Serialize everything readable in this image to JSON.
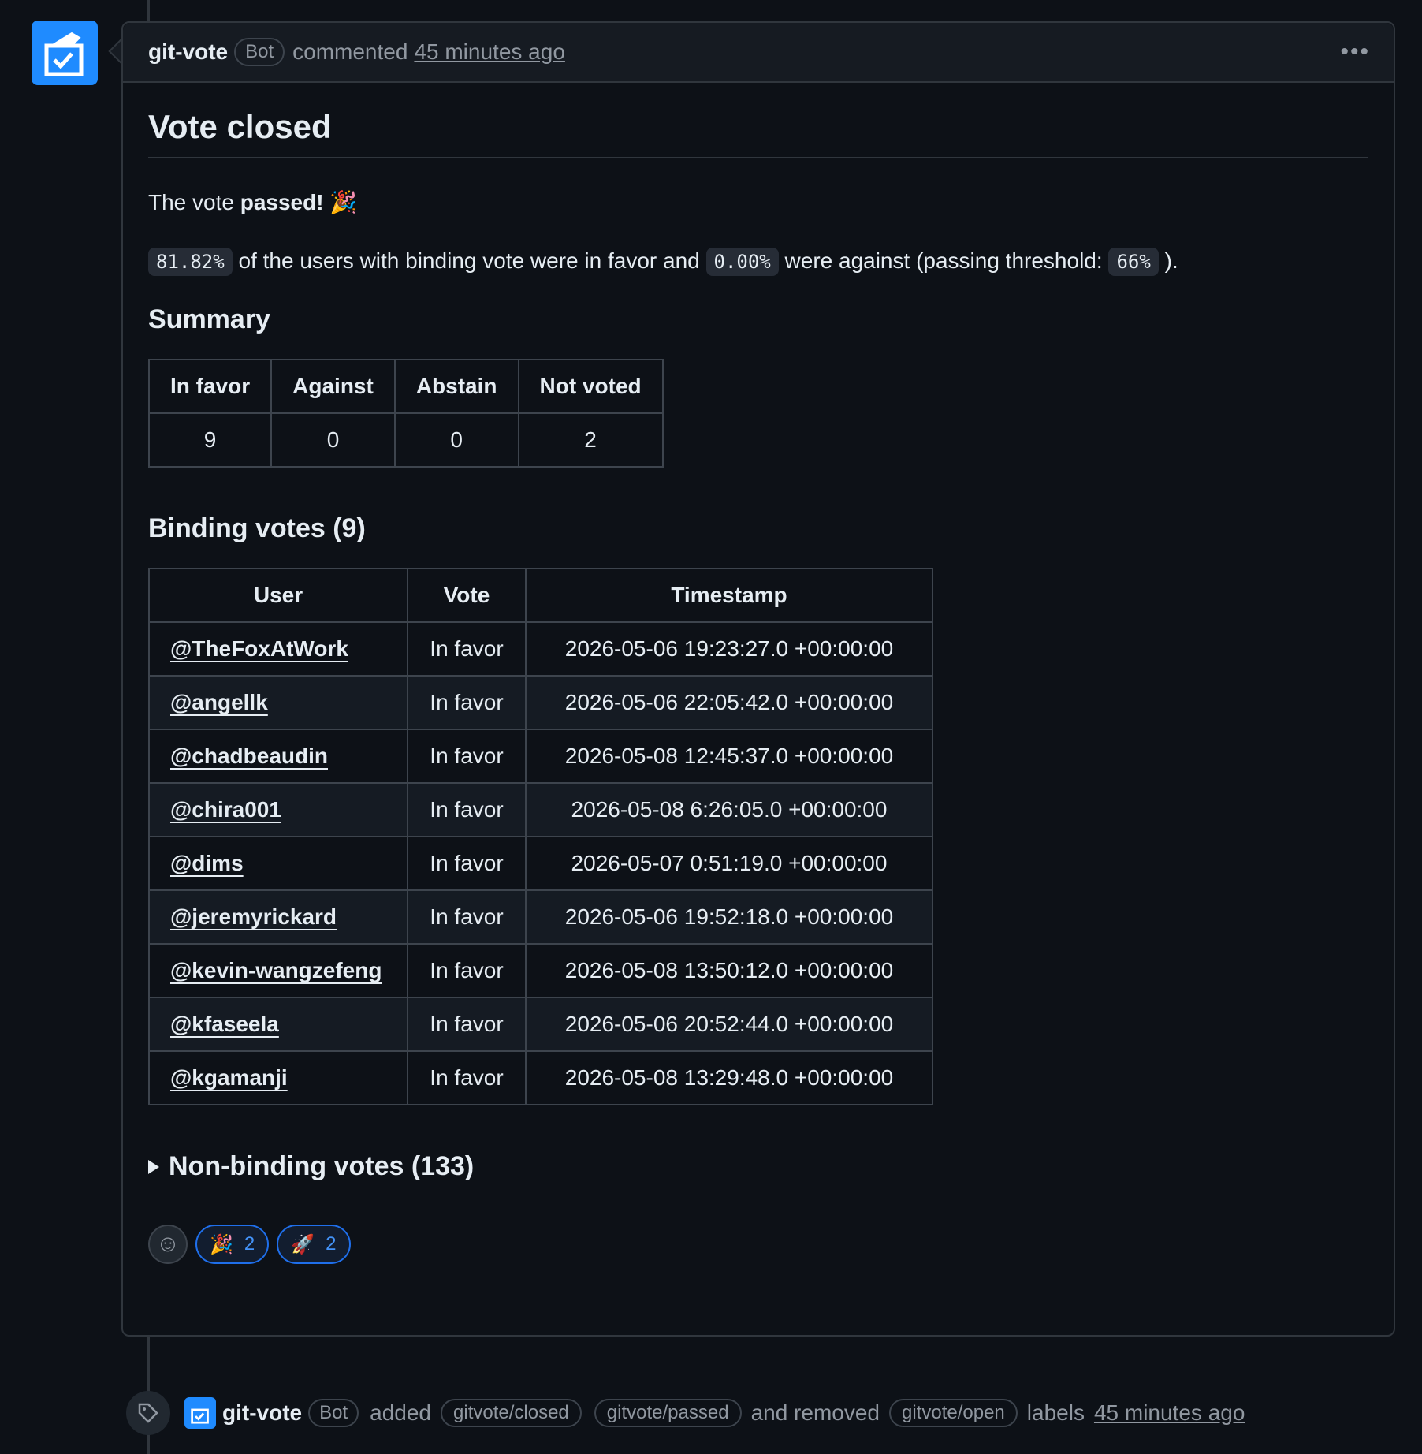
{
  "comment": {
    "author": "git-vote",
    "badge": "Bot",
    "action": "commented",
    "time": "45 minutes ago",
    "title": "Vote closed",
    "result_prefix": "The vote ",
    "result_word": "passed!",
    "result_emoji": "🎉",
    "stats": {
      "in_favor_pct": "81.82%",
      "text_1": " of the users with binding vote were in favor and ",
      "against_pct": "0.00%",
      "text_2": " were against (passing threshold: ",
      "threshold": "66%",
      "text_3": " )."
    },
    "summary": {
      "heading": "Summary",
      "headers": [
        "In favor",
        "Against",
        "Abstain",
        "Not voted"
      ],
      "values": [
        "9",
        "0",
        "0",
        "2"
      ]
    },
    "binding": {
      "heading": "Binding votes (9)",
      "headers": [
        "User",
        "Vote",
        "Timestamp"
      ],
      "rows": [
        {
          "user": "@TheFoxAtWork",
          "vote": "In favor",
          "ts": "2026-05-06 19:23:27.0 +00:00:00"
        },
        {
          "user": "@angellk",
          "vote": "In favor",
          "ts": "2026-05-06 22:05:42.0 +00:00:00"
        },
        {
          "user": "@chadbeaudin",
          "vote": "In favor",
          "ts": "2026-05-08 12:45:37.0 +00:00:00"
        },
        {
          "user": "@chira001",
          "vote": "In favor",
          "ts": "2026-05-08 6:26:05.0 +00:00:00"
        },
        {
          "user": "@dims",
          "vote": "In favor",
          "ts": "2026-05-07 0:51:19.0 +00:00:00"
        },
        {
          "user": "@jeremyrickard",
          "vote": "In favor",
          "ts": "2026-05-06 19:52:18.0 +00:00:00"
        },
        {
          "user": "@kevin-wangzefeng",
          "vote": "In favor",
          "ts": "2026-05-08 13:50:12.0 +00:00:00"
        },
        {
          "user": "@kfaseela",
          "vote": "In favor",
          "ts": "2026-05-06 20:52:44.0 +00:00:00"
        },
        {
          "user": "@kgamanji",
          "vote": "In favor",
          "ts": "2026-05-08 13:29:48.0 +00:00:00"
        }
      ]
    },
    "non_binding": "Non-binding votes (133)",
    "reactions": [
      {
        "emoji": "🎉",
        "count": "2"
      },
      {
        "emoji": "🚀",
        "count": "2"
      }
    ]
  },
  "event": {
    "author": "git-vote",
    "badge": "Bot",
    "added": "added",
    "label_closed": "gitvote/closed",
    "label_passed": "gitvote/passed",
    "removed": "and removed",
    "label_open": "gitvote/open",
    "labels": "labels",
    "time": "45 minutes ago"
  },
  "icons": {
    "avatar": "ballot-box-icon",
    "more": "kebab-menu-icon",
    "add_reaction": "smiley-icon",
    "event": "tag-icon"
  }
}
